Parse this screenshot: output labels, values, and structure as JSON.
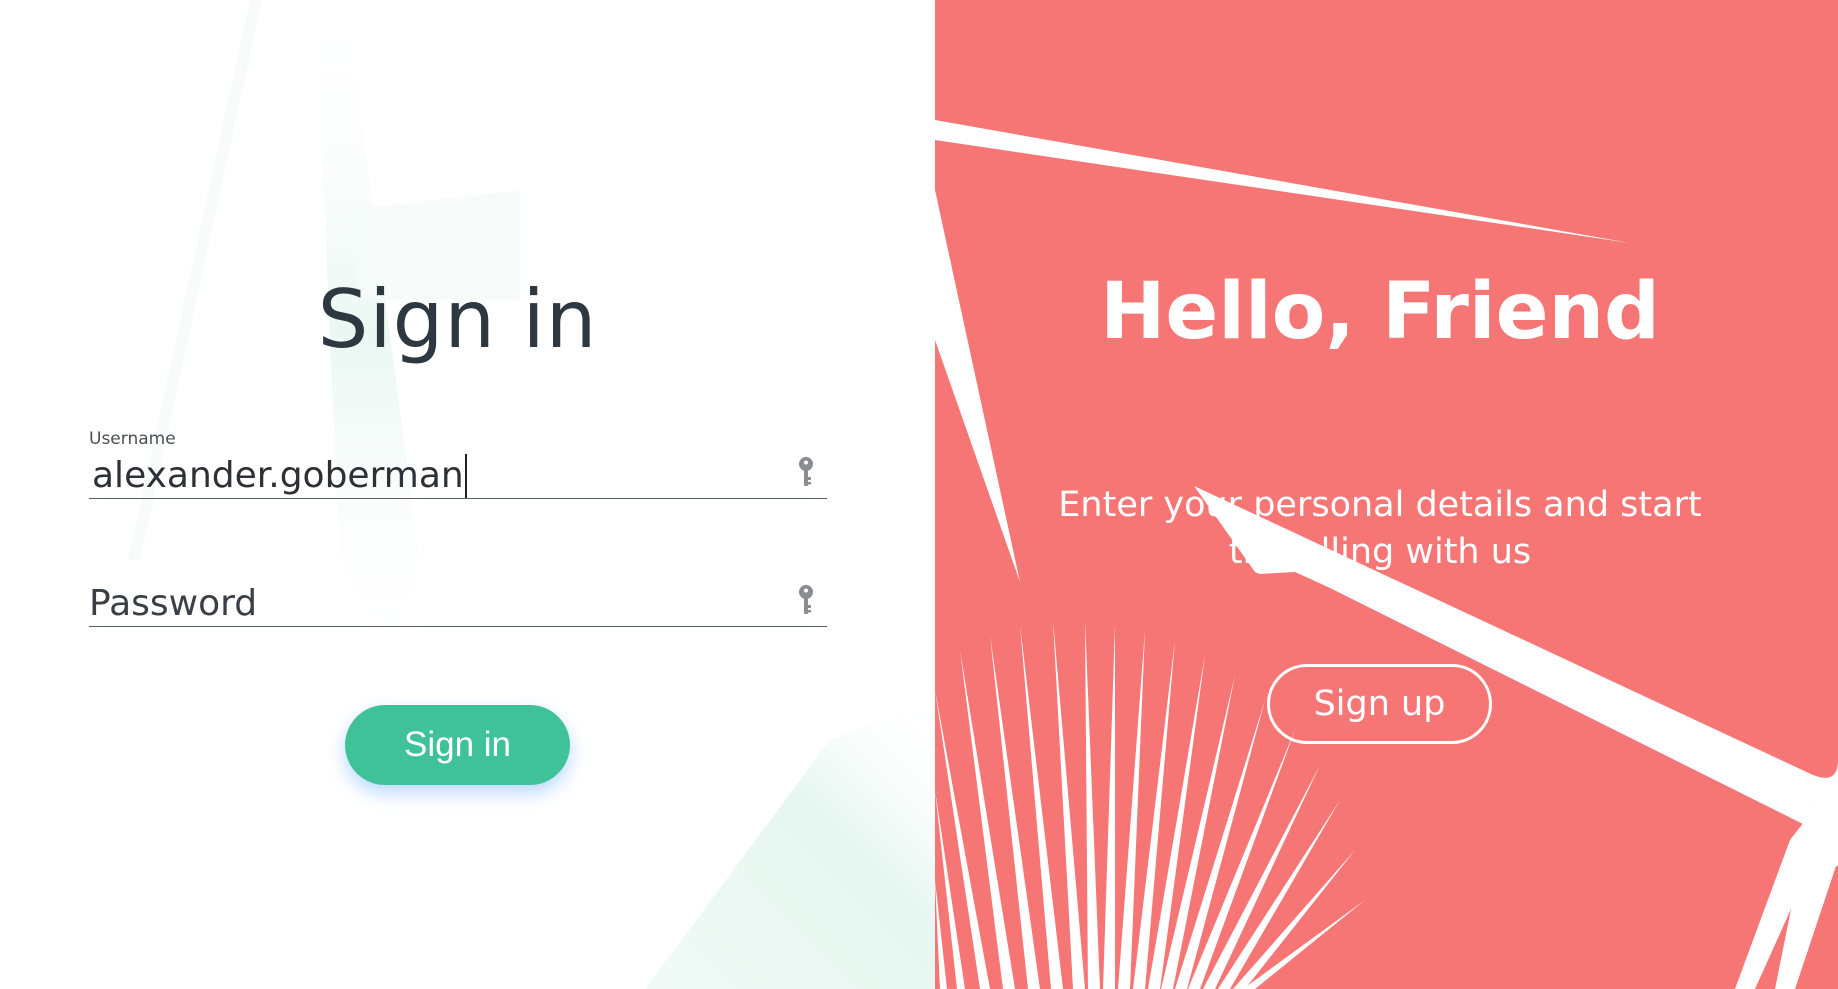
{
  "signin": {
    "title": "Sign in",
    "username": {
      "label": "Username",
      "value": "alexander.goberman",
      "icon": "key-icon"
    },
    "password": {
      "placeholder": "Password",
      "value": "",
      "icon": "key-icon"
    },
    "button_label": "Sign in"
  },
  "welcome": {
    "title": "Hello, Friend",
    "text": "Enter your personal details and start travelling with us",
    "button_label": "Sign up"
  },
  "colors": {
    "accent_green": "#40c298",
    "coral": "#f67676",
    "title_text": "#2e3840",
    "button_shadow": "#66aaff"
  }
}
